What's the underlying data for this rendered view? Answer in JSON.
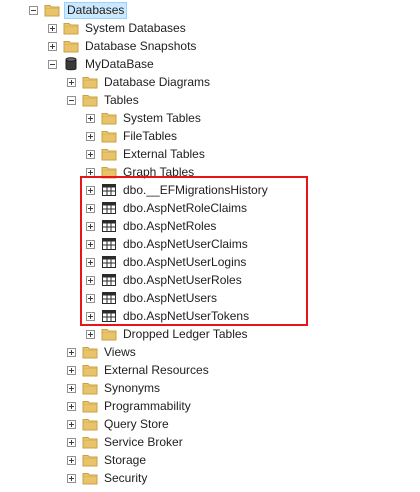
{
  "colors": {
    "folder": "#e8c36a",
    "folder_dark": "#c9a243",
    "selection_bg": "#cce8ff",
    "highlight_border": "#e8141a"
  },
  "tree": {
    "root": {
      "label": "Databases",
      "state": "expanded",
      "selected": true,
      "icon": "folder-icon"
    },
    "root_children": [
      {
        "label": "System Databases",
        "state": "collapsed",
        "icon": "folder-icon"
      },
      {
        "label": "Database Snapshots",
        "state": "collapsed",
        "icon": "folder-icon"
      },
      {
        "label": "MyDataBase",
        "state": "expanded",
        "icon": "database-icon"
      }
    ],
    "db_children": [
      {
        "label": "Database Diagrams",
        "state": "collapsed",
        "icon": "folder-icon"
      },
      {
        "label": "Tables",
        "state": "expanded",
        "icon": "folder-icon"
      }
    ],
    "tables_children": [
      {
        "label": "System Tables",
        "state": "collapsed",
        "icon": "folder-icon"
      },
      {
        "label": "FileTables",
        "state": "collapsed",
        "icon": "folder-icon"
      },
      {
        "label": "External Tables",
        "state": "collapsed",
        "icon": "folder-icon"
      },
      {
        "label": "Graph Tables",
        "state": "collapsed",
        "icon": "folder-icon"
      },
      {
        "label": "dbo.__EFMigrationsHistory",
        "state": "collapsed",
        "icon": "table-icon"
      },
      {
        "label": "dbo.AspNetRoleClaims",
        "state": "collapsed",
        "icon": "table-icon"
      },
      {
        "label": "dbo.AspNetRoles",
        "state": "collapsed",
        "icon": "table-icon"
      },
      {
        "label": "dbo.AspNetUserClaims",
        "state": "collapsed",
        "icon": "table-icon"
      },
      {
        "label": "dbo.AspNetUserLogins",
        "state": "collapsed",
        "icon": "table-icon"
      },
      {
        "label": "dbo.AspNetUserRoles",
        "state": "collapsed",
        "icon": "table-icon"
      },
      {
        "label": "dbo.AspNetUsers",
        "state": "collapsed",
        "icon": "table-icon"
      },
      {
        "label": "dbo.AspNetUserTokens",
        "state": "collapsed",
        "icon": "table-icon"
      },
      {
        "label": "Dropped Ledger Tables",
        "state": "collapsed",
        "icon": "folder-icon"
      }
    ],
    "db_children_after": [
      {
        "label": "Views",
        "state": "collapsed",
        "icon": "folder-icon"
      },
      {
        "label": "External Resources",
        "state": "collapsed",
        "icon": "folder-icon"
      },
      {
        "label": "Synonyms",
        "state": "collapsed",
        "icon": "folder-icon"
      },
      {
        "label": "Programmability",
        "state": "collapsed",
        "icon": "folder-icon"
      },
      {
        "label": "Query Store",
        "state": "collapsed",
        "icon": "folder-icon"
      },
      {
        "label": "Service Broker",
        "state": "collapsed",
        "icon": "folder-icon"
      },
      {
        "label": "Storage",
        "state": "collapsed",
        "icon": "folder-icon"
      },
      {
        "label": "Security",
        "state": "collapsed",
        "icon": "folder-icon"
      }
    ]
  }
}
